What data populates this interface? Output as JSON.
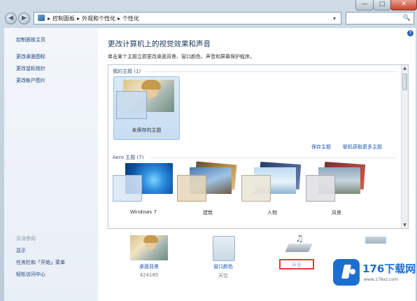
{
  "window": {
    "minimize_glyph": "—",
    "maximize_glyph": "□",
    "close_glyph": "✕"
  },
  "address": {
    "segments": [
      "控制面板",
      "外观和个性化",
      "个性化"
    ],
    "separator": "▸",
    "chevron": "▾"
  },
  "search": {
    "icon": "🔍"
  },
  "sidebar": {
    "links": [
      "控制面板主页",
      "更改桌面图标",
      "更改鼠标指针",
      "更改帐户图片"
    ],
    "see_also_heading": "另请参阅",
    "see_also": [
      "显示",
      "任务栏和「开始」菜单",
      "轻松访问中心"
    ]
  },
  "main": {
    "help_glyph": "?",
    "title": "更改计算机上的视觉效果和声音",
    "subtitle": "单击某个主题立即更改桌面背景、窗口颜色、声音和屏幕保护程序。",
    "my_themes_label": "我的主题 (1)",
    "unsaved_theme": "未保存的主题",
    "save_theme": "保存主题",
    "get_more_themes": "联机获取更多主题",
    "aero_label": "Aero 主题 (7)",
    "aero_themes": [
      "Windows 7",
      "建筑",
      "人物",
      "风景"
    ]
  },
  "bottom": {
    "desktop_background": {
      "label": "桌面背景",
      "value": "424185"
    },
    "window_color": {
      "label": "窗口颜色",
      "value": "天空"
    },
    "sound": {
      "label": "声音"
    },
    "screensaver": {
      "label": ""
    }
  },
  "watermark": {
    "brand": "176下载网",
    "url": "www.176xz.com"
  },
  "colors": {
    "link": "#1a55b5",
    "title": "#1e395b",
    "highlight": "#e5393b",
    "watermark_blue": "#1e6ed2"
  }
}
